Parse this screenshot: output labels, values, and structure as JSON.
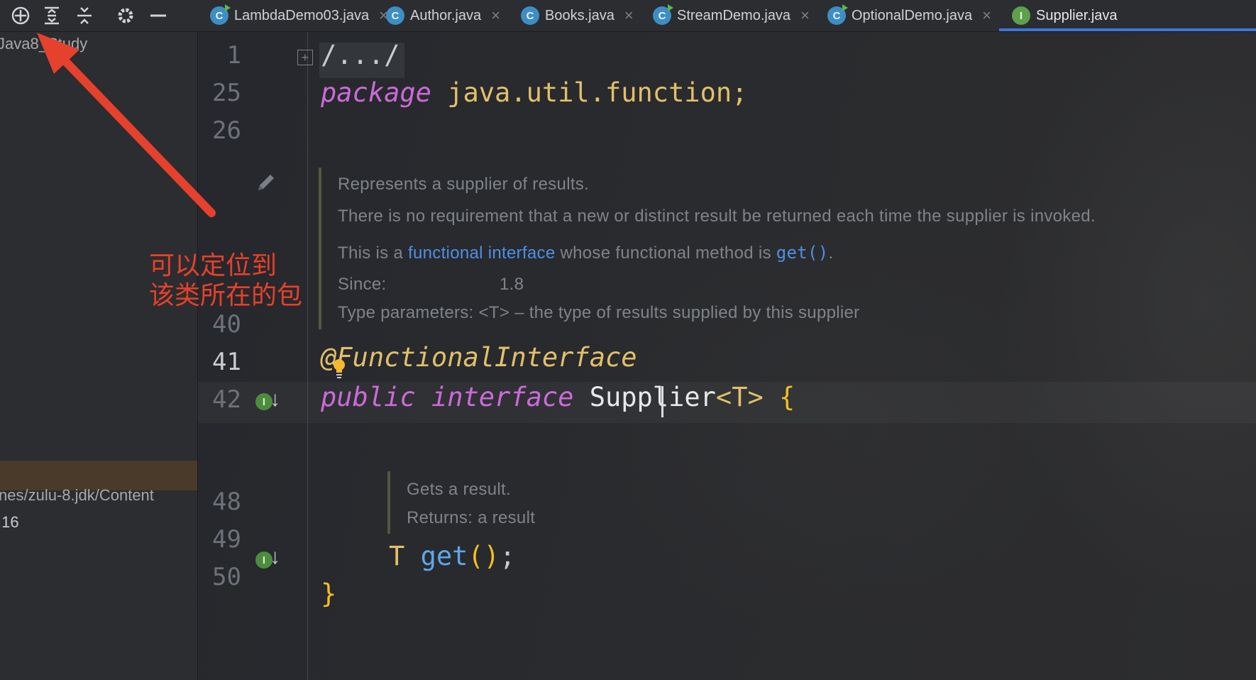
{
  "toolbar": {
    "icons": [
      "locate-icon",
      "expand-all-icon",
      "collapse-all-icon",
      "gear-icon",
      "minimize-icon"
    ]
  },
  "tabs": [
    {
      "label": "LambdaDemo03.java",
      "icon": "C",
      "closable": true
    },
    {
      "label": "Author.java",
      "icon": "C",
      "closable": true
    },
    {
      "label": "Books.java",
      "icon": "C",
      "closable": true
    },
    {
      "label": "StreamDemo.java",
      "icon": "C",
      "closable": true
    },
    {
      "label": "OptionalDemo.java",
      "icon": "C",
      "closable": true
    },
    {
      "label": "Supplier.java",
      "icon": "I",
      "closable": false,
      "active": true
    }
  ],
  "tab_close_glyph": "×",
  "project_panel": {
    "root_label": "Java8_Study",
    "jdk_path": "nes/zulu-8.jdk/Content",
    "version_text": ".16"
  },
  "annotation": {
    "line1": "可以定位到",
    "line2": "该类所在的包",
    "color": "#e8402a"
  },
  "editor": {
    "line_numbers": [
      "1",
      "25",
      "26",
      "40",
      "41",
      "42",
      "48",
      "49",
      "50"
    ],
    "folded_header": "/.../",
    "fold_glyph": "+",
    "package_kw": "package",
    "package_name": "java.util.function;",
    "doc1": {
      "line1": "Represents a supplier of results.",
      "line2": "There is no requirement that a new or distinct result be returned each time the supplier is invoked.",
      "line3_pre": "This is a ",
      "line3_link": "functional interface",
      "line3_mid": " whose functional method is ",
      "line3_code": "get()",
      "line3_post": ".",
      "since_label": "Since:",
      "since_value": "1.8",
      "type_params": "Type parameters: <T> – the type of results supplied by this supplier"
    },
    "annotation_at": "@",
    "annotation_name": "FunctionalInterface",
    "decl_public": "public",
    "decl_interface": "interface",
    "decl_name": "Supplier",
    "decl_generic": "<T>",
    "decl_brace": "{",
    "doc2": {
      "line1": "Gets a result.",
      "line2": "Returns: a result"
    },
    "method_type": "T",
    "method_name": "get",
    "method_paren_open": "(",
    "method_paren_close": ")",
    "method_semicolon": ";",
    "close_brace": "}",
    "gutter_icon_letter": "I",
    "gutter_arrow": "↓"
  },
  "colors": {
    "keyword": "#cc6ad8",
    "package": "#e2c06a",
    "method": "#5ea7ea",
    "link": "#4f8fe6",
    "active_tab_underline": "#3d75d8"
  }
}
